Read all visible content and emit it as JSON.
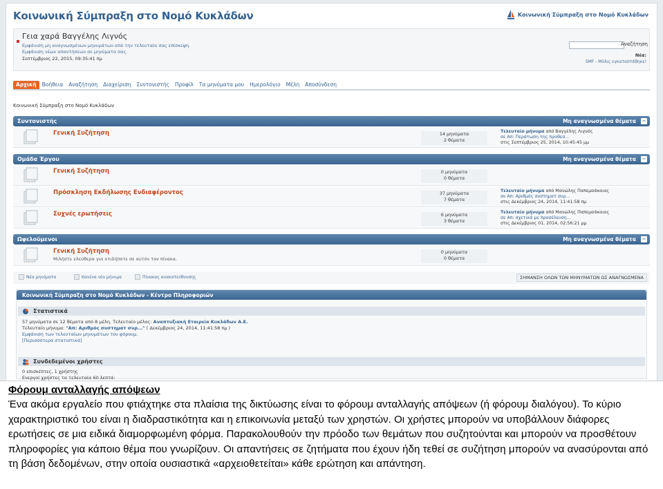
{
  "forum": {
    "site_title": "Κοινωνική Σύμπραξη στο Νομό Κυκλάδων",
    "logo_text": "Κοινωνική Σύμπραξη στο Νομό Κυκλάδων",
    "user": {
      "greeting": "Γεια χαρά Βαγγέλης Λιγνός",
      "line1": "Εμφάνιση μη αναγνωσμένων μηνυμάτων από την τελευταία σας επίσκεψη.",
      "line2": "Εμφάνιση νέων απαντήσεων σε μηνύματα σας.",
      "date": "Σεπτέμβριος 22, 2015, 09:35:41 πμ"
    },
    "search": {
      "button": "Αναζήτηση",
      "news_label": "Νέα:",
      "smf_text": "SMF - Μόλις εγκαταστάθηκε!"
    },
    "nav": [
      "Αρχική",
      "Βοήθεια",
      "Αναζήτηση",
      "Διαχείριση",
      "Συντονιστής",
      "Προφίλ",
      "Τα μηνύματα μου",
      "Ημερολόγιο",
      "Μέλη",
      "Αποσύνδεση"
    ],
    "breadcrumb": "Κοινωνική Σύμπραξη στο Νομό Κυκλάδων",
    "categories": [
      {
        "title": "Συντονιστής",
        "right": "Μη αναγνωσμένα θέματα",
        "boards": [
          {
            "name": "Γενική Συζήτηση",
            "desc": "",
            "posts": "14 μηνύματα",
            "topics": "2 θέματα",
            "last_label": "Τελευταίο μήνυμα",
            "last_by": "από Βαγγέλης Λιγνός",
            "last_in": "σε Απ: Περάτωση της προθεσ...",
            "last_date": "στις Σεπτέμβριος 25, 2014, 10:45:45 μμ"
          }
        ]
      },
      {
        "title": "Ομάδα Έργου",
        "right": "Μη αναγνωσμένα θέματα",
        "boards": [
          {
            "name": "Γενική Συζήτηση",
            "desc": "",
            "posts": "0 μηνύματα",
            "topics": "0 θέματα",
            "last_label": "",
            "last_by": "",
            "last_in": "",
            "last_date": ""
          },
          {
            "name": "Πρόσκληση Εκδήλωσης Ενδιαφέροντος",
            "desc": "",
            "posts": "37 μηνύματα",
            "topics": "7 θέματα",
            "last_label": "Τελευταίο μήνυμα",
            "last_by": "από Μανώλης Παπεμαάκαιος",
            "last_in": "σε Απ: Αριθμός συστηματ συρ...",
            "last_date": "στις Δεκέμβριος 24, 2014, 11:41:58 πμ"
          },
          {
            "name": "Συχνές ερωτήσεις",
            "desc": "",
            "posts": "6 μηνύματα",
            "topics": "3 θέματα",
            "last_label": "Τελευταίο μήνυμα",
            "last_by": "από Μανώλης Παπεμαάκαιος",
            "last_in": "σε Απ: σχετικά με προσέλευση...",
            "last_date": "στις Δεκέμβριος 01, 2014, 02:56:21 μμ"
          }
        ]
      },
      {
        "title": "Ωφελούμενοι",
        "right": "Μη αναγνωσμένα θέματα",
        "boards": [
          {
            "name": "Γενική Συζήτηση",
            "desc": "Μιλήστε ελεύθερα για οτιδήποτε σε αυτόν τον πίνακα.",
            "posts": "0 μηνύματα",
            "topics": "0 θέματα",
            "last_label": "",
            "last_by": "",
            "last_in": "",
            "last_date": ""
          }
        ]
      }
    ],
    "legend": [
      "Νέα μηνύματα",
      "Κανένα νέο μήνυμα",
      "Πίνακας ανακατεύθυνσης"
    ],
    "mark_read": "ΣΗΜΑΝΣΗ ΟΛΩΝ ΤΩΝ ΜΗΝΥΜΑΤΩΝ ΩΣ ΑΝΑΓΝΩΣΜΕΝΑ",
    "info_center": {
      "title": "Κοινωνική Σύμπραξη στο Νομό Κυκλάδων - Κέντρο Πληροφοριών",
      "stats_title": "Στατιστικά",
      "stats_line1a": "57 μηνύματα σε 12 θέματα από 8 μέλη. Τελευταίο μέλος: ",
      "stats_line1b": "Αναπτυξιακή Εταιρεία Κυκλάδων Α.Ε.",
      "stats_line2a": "Τελευταίο μήνυμα: ",
      "stats_line2b": "\"Απ: Αριθμός συστηματ συρ...\"",
      "stats_line2c": " ( Δεκέμβριος 24, 2014, 11:41:58 πμ )",
      "stats_line3": "Εμφάνιση των τελευταίων μηνυμάτων του φόρουμ.",
      "stats_line4": "[Περισσότερα στατιστικά]",
      "online_title": "Συνδεδεμένοι χρήστες",
      "online_line1": "0 επισκέπτες, 1 χρήστης",
      "online_line2": "Ενεργοί χρήστες τα τελευταία 60 λεπτά:"
    }
  },
  "caption": {
    "title": "Φόρουμ ανταλλαγής απόψεων",
    "body": "Ένα ακόμα εργαλείο που φτιάχτηκε στα πλαίσια της δικτύωσης είναι το φόρουμ ανταλλαγής απόψεων (ή φόρουμ διαλόγου). Το κύριο χαρακτηριστικό του είναι η διαδραστικότητα και η επικοινωνία μεταξύ των χρηστών. Οι χρήστες μπορούν να υποβάλλουν διάφορες ερωτήσεις σε μια ειδικά διαμορφωμένη φόρμα. Παρακολουθούν την πρόοδο των θεμάτων που συζητούνται και μπορούν να προσθέτουν πληροφορίες για κάποιο θέμα που γνωρίζουν. Οι απαντήσεις σε ζητήματα που έχουν ήδη τεθεί σε συζήτηση μπορούν να ανασύρονται από τη βάση δεδομένων, στην οποία ουσιαστικά «αρχειοθετείται» κάθε ερώτηση και απάντηση."
  }
}
